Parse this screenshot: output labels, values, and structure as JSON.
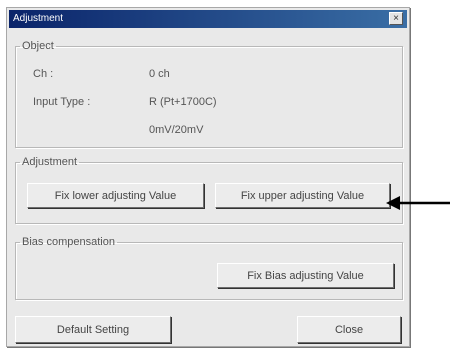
{
  "window": {
    "title": "Adjustment",
    "close_glyph": "×"
  },
  "object_group": {
    "legend": "Object",
    "ch_label": "Ch :",
    "ch_value": "0 ch",
    "input_type_label": "Input Type :",
    "input_type_value": "R (Pt+1700C)",
    "range_value": "0mV/20mV"
  },
  "adjustment_group": {
    "legend": "Adjustment",
    "fix_lower_label": "Fix lower adjusting Value",
    "fix_upper_label": "Fix upper adjusting Value"
  },
  "bias_group": {
    "legend": "Bias compensation",
    "fix_bias_label": "Fix Bias adjusting Value"
  },
  "footer": {
    "default_setting_label": "Default Setting",
    "close_label": "Close"
  },
  "colors": {
    "titlebar_start": "#0a246a",
    "titlebar_end": "#3a6ea5",
    "dialog_bg": "#e9e9e9",
    "arrow": "#000000"
  },
  "icons": {
    "close": "close-icon",
    "pointer": "arrow-pointer-icon"
  }
}
